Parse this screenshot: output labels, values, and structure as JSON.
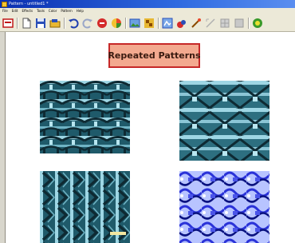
{
  "window": {
    "title": "Pattern - untitled1 *"
  },
  "menu": {
    "items": [
      "File",
      "Edit",
      "Effects",
      "Tools",
      "Color",
      "Pattern",
      "Help"
    ]
  },
  "toolbar": {
    "icons": [
      "app-logo-icon",
      "new-file-icon",
      "save-icon",
      "open-folder-icon",
      "undo-icon",
      "redo-icon",
      "stop-icon",
      "color-wheel-icon",
      "gallery-icon",
      "pattern-tool-icon",
      "effects-icon",
      "brush-icon",
      "wand-icon",
      "tile-icon",
      "grid-icon",
      "settings-gear-icon"
    ]
  },
  "canvas": {
    "banner_text": "Repeated Patterns",
    "patterns": [
      {
        "name": "pattern-teal-arches",
        "palette": [
          "#1f5a6a",
          "#9ed6e4",
          "#0e2a33"
        ]
      },
      {
        "name": "pattern-teal-crosses",
        "palette": [
          "#1f5a6a",
          "#9ed6e4",
          "#0e2a33"
        ]
      },
      {
        "name": "pattern-teal-chevrons",
        "palette": [
          "#1f5a6a",
          "#9ed6e4",
          "#0e2a33"
        ]
      },
      {
        "name": "pattern-blue-waves",
        "palette": [
          "#2a32d8",
          "#b8c4ff",
          "#0a1280"
        ]
      }
    ]
  },
  "colors": {
    "titlebar": "#0a2fb0",
    "chrome": "#ece9d8",
    "banner_fill": "#f3a98f",
    "banner_border": "#c62828"
  }
}
